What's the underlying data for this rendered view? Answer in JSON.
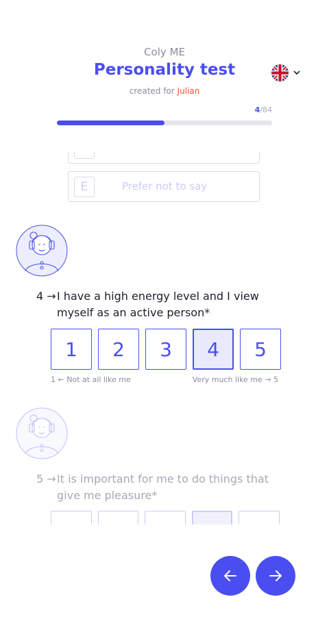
{
  "header": {
    "brand": "Coly ME",
    "title": "Personality test",
    "created_prefix": "created for ",
    "created_name": "Julian",
    "language": {
      "flag_icon": "uk-flag-icon",
      "chevron_icon": "chevron-down-icon"
    }
  },
  "progress": {
    "current": "4",
    "separator": "/",
    "total": "84",
    "fraction": 0.5
  },
  "previous_options": [
    {
      "key": "",
      "label": ""
    },
    {
      "key": "E",
      "label": "Prefer not to say"
    }
  ],
  "question_current": {
    "number": "4 →",
    "text": "I have a high energy level and I view myself as an active person*",
    "scale": [
      "1",
      "2",
      "3",
      "4",
      "5"
    ],
    "selected": "4",
    "low_label": "1 ← Not at all like me",
    "high_label": "Very much like me → 5"
  },
  "question_next": {
    "number": "5 →",
    "text": "It is important for me to do things that give me pleasure*"
  },
  "nav": {
    "prev_icon": "arrow-left-icon",
    "next_icon": "arrow-right-icon"
  },
  "colors": {
    "accent": "#4a4ef0",
    "highlight": "#f2542d",
    "track": "#e4e6eb"
  }
}
